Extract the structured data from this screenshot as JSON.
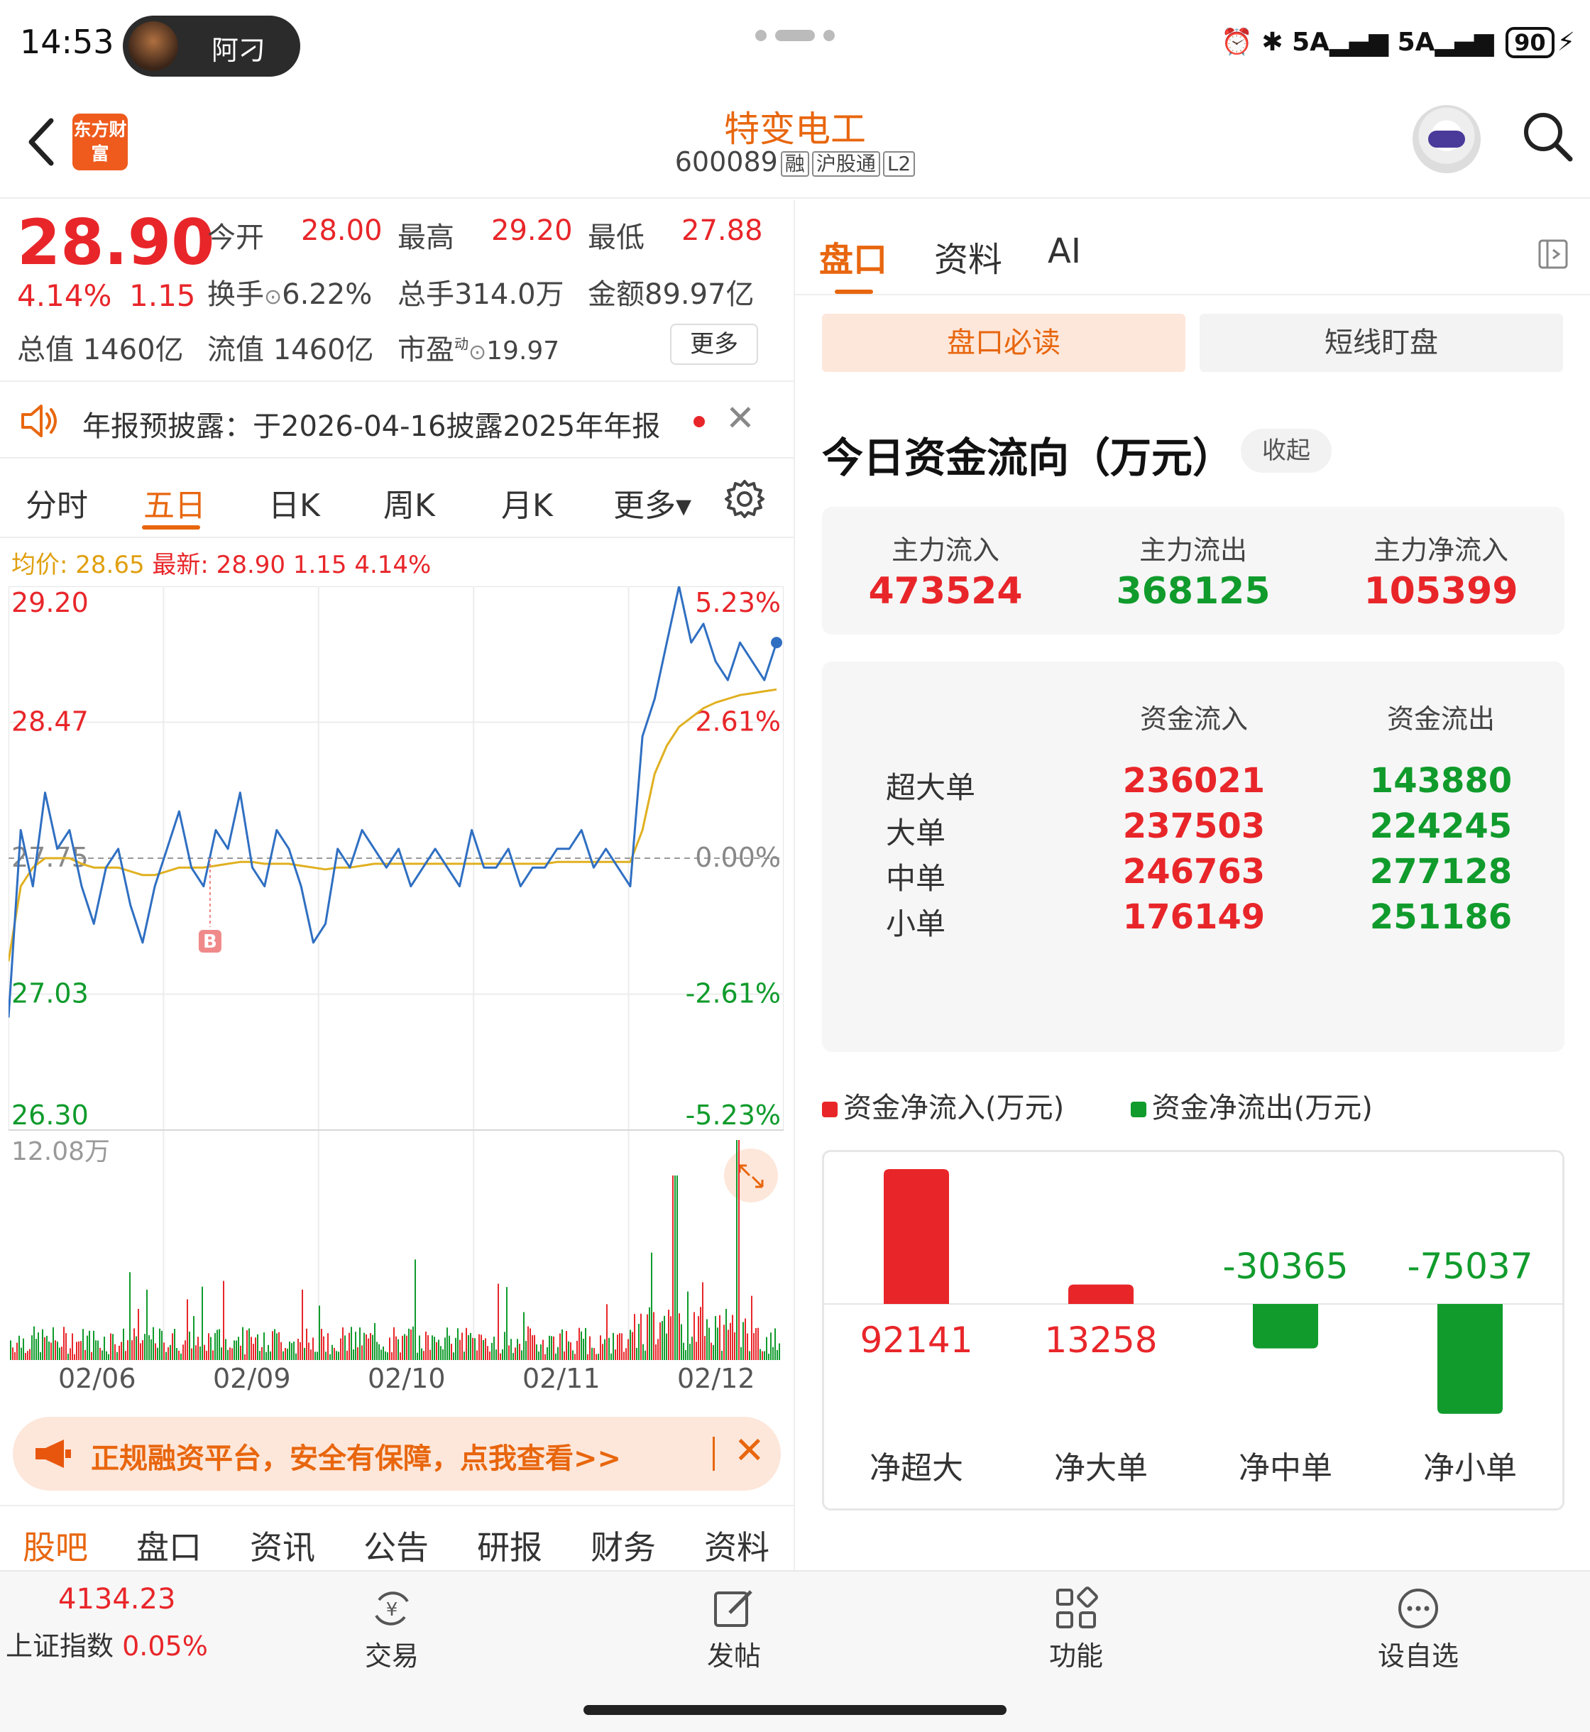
{
  "status": {
    "time": "14:53",
    "pill_text": "阿刁",
    "battery": "90",
    "signal_a": "5A",
    "signal_b": "5A"
  },
  "header": {
    "brand_logo_text": "东方财富",
    "stock_name": "特变电工",
    "stock_code": "600089",
    "tags": [
      "融",
      "沪股通",
      "L2"
    ]
  },
  "quote": {
    "price": "28.90",
    "change_pct": "4.14%",
    "change": "1.15",
    "open_label": "今开",
    "open": "28.00",
    "high_label": "最高",
    "high": "29.20",
    "low_label": "最低",
    "low": "27.88",
    "turnover_label": "换手",
    "turnover": "6.22%",
    "volume_label": "总手",
    "volume": "314.0万",
    "amount_label": "金额",
    "amount": "89.97亿",
    "mcap_label": "总值",
    "mcap": "1460亿",
    "float_label": "流值",
    "float_cap": "1460亿",
    "pe_label": "市盈",
    "pe_sup": "动",
    "pe": "19.97",
    "more": "更多"
  },
  "notice": {
    "text": "年报预披露：于2026-04-16披露2025年年报"
  },
  "chart_tabs": [
    "分时",
    "五日",
    "日K",
    "周K",
    "月K",
    "更多▾"
  ],
  "chart_tab_active": 1,
  "chart_header": {
    "avg_label": "均价: 28.65",
    "latest_label": "最新: 28.90 1.15 4.14%"
  },
  "chart_data": {
    "type": "line",
    "title": "",
    "x_categories": [
      "02/06",
      "02/09",
      "02/10",
      "02/11",
      "02/12"
    ],
    "y_left_ticks": [
      "29.20",
      "28.47",
      "27.75",
      "27.03",
      "26.30"
    ],
    "y_right_ticks": [
      "5.23%",
      "2.61%",
      "0.00%",
      "-2.61%",
      "-5.23%"
    ],
    "ylim": [
      26.3,
      29.2
    ],
    "prev_close": 27.75,
    "series": [
      {
        "name": "最新",
        "color": "#2f6fc2",
        "values": [
          26.9,
          27.9,
          27.6,
          28.1,
          27.8,
          27.9,
          27.6,
          27.4,
          27.7,
          27.8,
          27.5,
          27.3,
          27.6,
          27.8,
          28.0,
          27.7,
          27.6,
          27.9,
          27.8,
          28.1,
          27.7,
          27.6,
          27.9,
          27.8,
          27.6,
          27.3,
          27.4,
          27.8,
          27.7,
          27.9,
          27.8,
          27.7,
          27.8,
          27.6,
          27.7,
          27.8,
          27.7,
          27.6,
          27.9,
          27.7,
          27.7,
          27.8,
          27.6,
          27.7,
          27.7,
          27.8,
          27.8,
          27.9,
          27.7,
          27.8,
          27.7,
          27.6,
          28.4,
          28.6,
          28.9,
          29.2,
          28.9,
          29.0,
          28.8,
          28.7,
          28.9,
          28.8,
          28.7,
          28.9
        ]
      },
      {
        "name": "均价",
        "color": "#e0b020",
        "values": [
          27.2,
          27.6,
          27.7,
          27.75,
          27.75,
          27.75,
          27.72,
          27.7,
          27.7,
          27.7,
          27.68,
          27.66,
          27.66,
          27.68,
          27.7,
          27.7,
          27.7,
          27.71,
          27.72,
          27.73,
          27.73,
          27.72,
          27.72,
          27.72,
          27.71,
          27.7,
          27.69,
          27.7,
          27.7,
          27.71,
          27.72,
          27.72,
          27.72,
          27.72,
          27.72,
          27.72,
          27.72,
          27.72,
          27.72,
          27.72,
          27.72,
          27.72,
          27.72,
          27.72,
          27.72,
          27.73,
          27.73,
          27.73,
          27.73,
          27.73,
          27.73,
          27.73,
          27.9,
          28.2,
          28.35,
          28.45,
          28.5,
          28.55,
          28.58,
          28.6,
          28.62,
          28.63,
          28.64,
          28.65
        ]
      }
    ],
    "volume_max_label": "12.08万",
    "buy_marker": "B"
  },
  "promo": {
    "text": "正规融资平台，安全有保障，点我查看>>"
  },
  "section_tabs": [
    "股吧",
    "盘口",
    "资讯",
    "公告",
    "研报",
    "财务",
    "资料"
  ],
  "right_panel": {
    "tabs": [
      "盘口",
      "资料",
      "AI"
    ],
    "sub_tabs": [
      "盘口必读",
      "短线盯盘"
    ],
    "flow_title": "今日资金流向（万元）",
    "collapse": "收起",
    "main": [
      {
        "label": "主力流入",
        "value": "473524",
        "color": "#e8262a"
      },
      {
        "label": "主力流出",
        "value": "368125",
        "color": "#109b2c"
      },
      {
        "label": "主力净流入",
        "value": "105399",
        "color": "#e8262a"
      }
    ],
    "detail_headers": [
      "资金流入",
      "资金流出"
    ],
    "detail_rows": [
      {
        "label": "超大单",
        "in": "236021",
        "out": "143880"
      },
      {
        "label": "大单",
        "in": "237503",
        "out": "224245"
      },
      {
        "label": "中单",
        "in": "246763",
        "out": "277128"
      },
      {
        "label": "小单",
        "in": "176149",
        "out": "251186"
      }
    ],
    "legend_in": "资金净流入(万元)",
    "legend_out": "资金净流出(万元)",
    "net_bars": [
      {
        "label": "净超大",
        "value": 92141,
        "text": "92141"
      },
      {
        "label": "净大单",
        "value": 13258,
        "text": "13258"
      },
      {
        "label": "净中单",
        "value": -30365,
        "text": "-30365"
      },
      {
        "label": "净小单",
        "value": -75037,
        "text": "-75037"
      }
    ]
  },
  "bottom_nav": {
    "index_value": "4134.23",
    "index_name": "上证指数",
    "index_pct": "0.05%",
    "items": [
      "交易",
      "发帖",
      "功能",
      "设自选"
    ]
  }
}
